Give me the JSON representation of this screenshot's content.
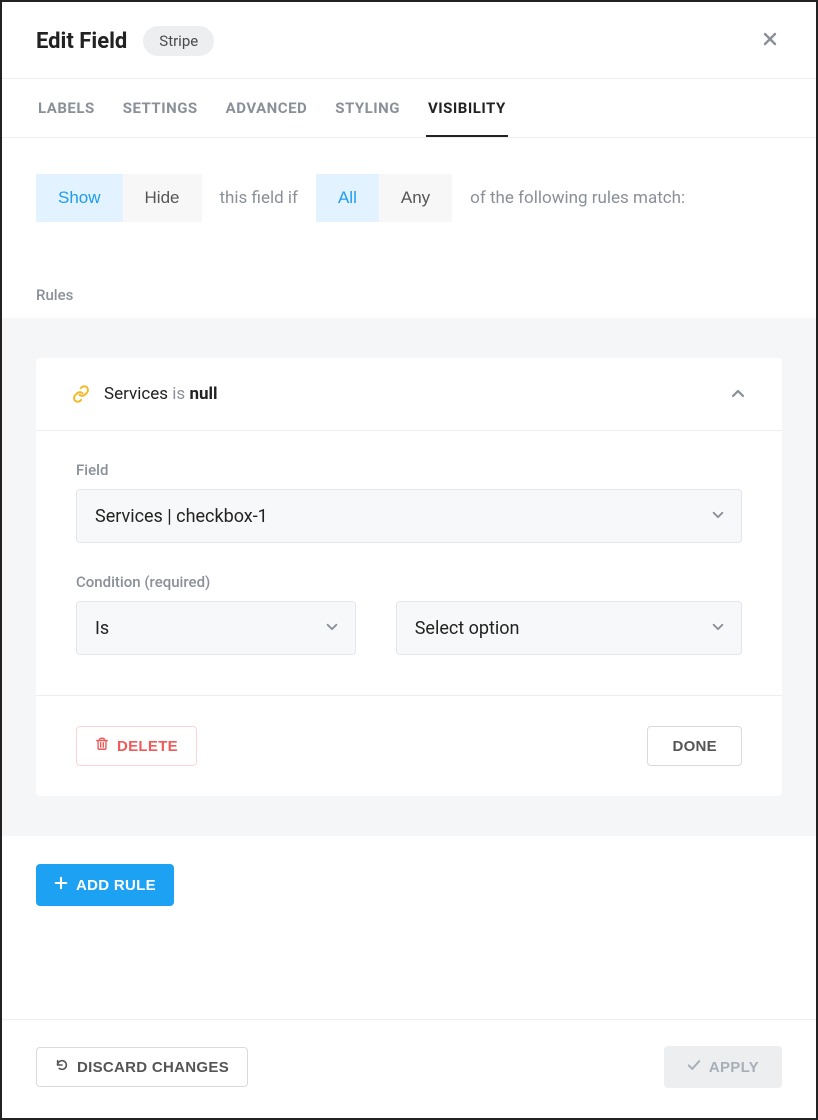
{
  "header": {
    "title": "Edit Field",
    "badge": "Stripe"
  },
  "tabs": {
    "items": [
      {
        "label": "LABELS",
        "active": false
      },
      {
        "label": "SETTINGS",
        "active": false
      },
      {
        "label": "ADVANCED",
        "active": false
      },
      {
        "label": "STYLING",
        "active": false
      },
      {
        "label": "VISIBILITY",
        "active": true
      }
    ]
  },
  "visibility": {
    "showhide": {
      "show": "Show",
      "hide": "Hide",
      "selected": "show"
    },
    "sentence_mid": "this field if",
    "allany": {
      "all": "All",
      "any": "Any",
      "selected": "all"
    },
    "sentence_end": "of the following rules match:"
  },
  "rules_label": "Rules",
  "rule": {
    "summary_field": "Services",
    "summary_op": "is",
    "summary_val": "null",
    "field_label": "Field",
    "field_value": "Services | checkbox-1",
    "condition_label": "Condition (required)",
    "condition_value": "Is",
    "option_value": "Select option",
    "delete_label": "DELETE",
    "done_label": "DONE"
  },
  "add_rule_label": "ADD RULE",
  "footer": {
    "discard_label": "DISCARD CHANGES",
    "apply_label": "APPLY"
  }
}
